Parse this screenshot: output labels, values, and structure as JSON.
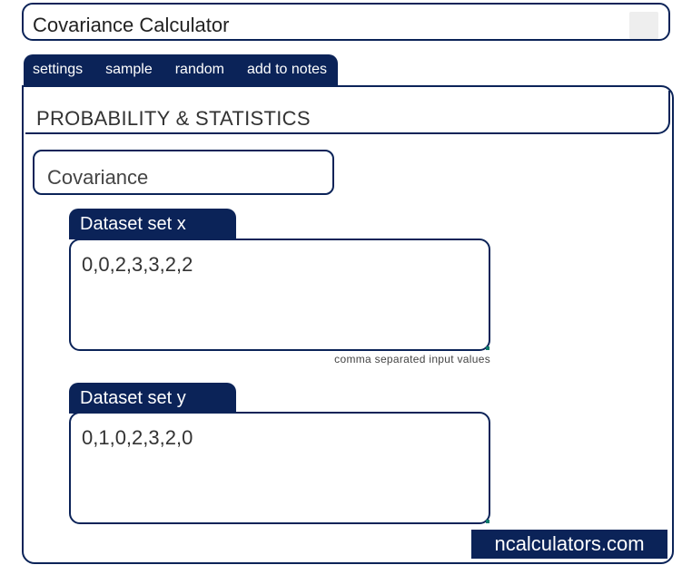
{
  "app": {
    "title": "Covariance Calculator"
  },
  "toolbar": {
    "settings": "settings",
    "sample": "sample",
    "random": "random",
    "add_to_notes": "add to notes"
  },
  "section": {
    "heading": "PROBABILITY & STATISTICS"
  },
  "calculator": {
    "name": "Covariance"
  },
  "dataset_x": {
    "label": "Dataset set x",
    "value": "0,0,2,3,3,2,2",
    "hint": "comma separated input values"
  },
  "dataset_y": {
    "label": "Dataset set y",
    "value": "0,1,0,2,3,2,0"
  },
  "brand": {
    "text": "ncalculators.com"
  },
  "colors": {
    "primary": "#0b2358",
    "background": "#ffffff",
    "title_square": "#eeeeee"
  }
}
